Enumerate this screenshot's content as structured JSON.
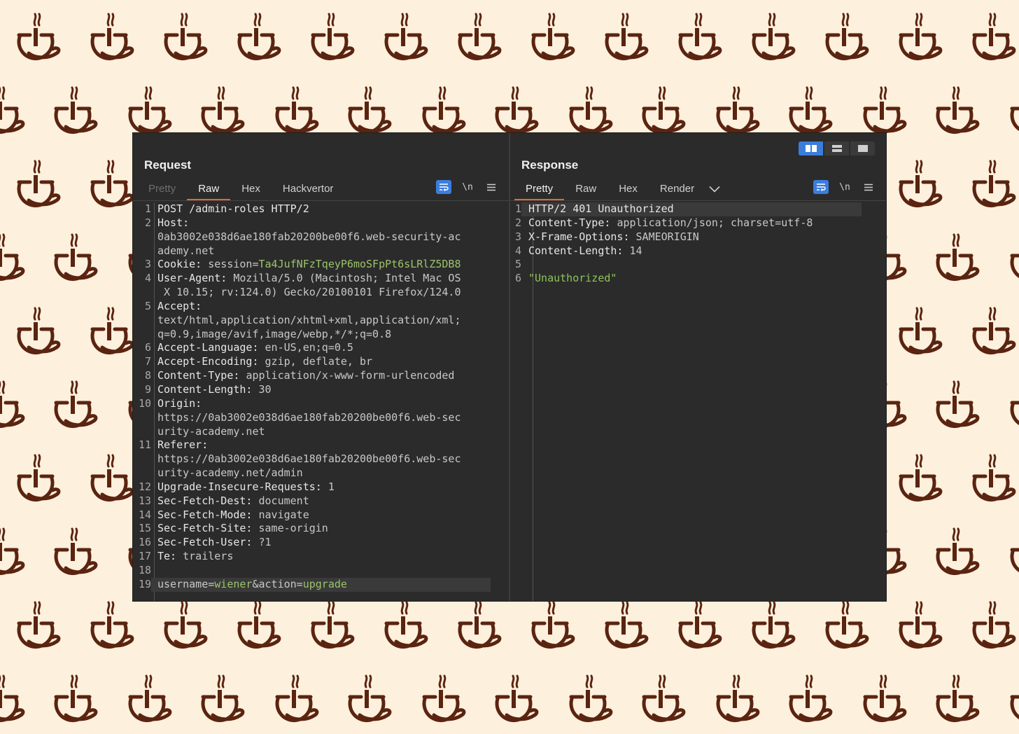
{
  "request": {
    "title": "Request",
    "tabs": [
      "Pretty",
      "Raw",
      "Hex",
      "Hackvertor"
    ],
    "newline_label": "\\n",
    "lines": {
      "l1": "POST /admin-roles HTTP/2",
      "l2": "Host:",
      "l2b": "0ab3002e038d6ae180fab20200be00f6.web-security-ac",
      "l2c": "ademy.net",
      "l3k": "Cookie:",
      "l3p": "session=",
      "l3v": "Ta4JufNFzTqeyP6moSFpPt6sLRlZ5DB8",
      "l4k": "User-Agent:",
      "l4v": "Mozilla/5.0 (Macintosh; Intel Mac OS",
      "l4b": " X 10.15; rv:124.0) Gecko/20100101 Firefox/124.0",
      "l5k": "Accept:",
      "l5b": "text/html,application/xhtml+xml,application/xml;",
      "l5c": "q=0.9,image/avif,image/webp,*/*;q=0.8",
      "l6k": "Accept-Language:",
      "l6v": "en-US,en;q=0.5",
      "l7k": "Accept-Encoding:",
      "l7v": "gzip, deflate, br",
      "l8k": "Content-Type:",
      "l8v": "application/x-www-form-urlencoded",
      "l9k": "Content-Length:",
      "l9v": "30",
      "l10k": "Origin:",
      "l10b": "https://0ab3002e038d6ae180fab20200be00f6.web-sec",
      "l10c": "urity-academy.net",
      "l11k": "Referer:",
      "l11b": "https://0ab3002e038d6ae180fab20200be00f6.web-sec",
      "l11c": "urity-academy.net/admin",
      "l12k": "Upgrade-Insecure-Requests:",
      "l12v": "1",
      "l13k": "Sec-Fetch-Dest:",
      "l13v": "document",
      "l14k": "Sec-Fetch-Mode:",
      "l14v": "navigate",
      "l15k": "Sec-Fetch-Site:",
      "l15v": "same-origin",
      "l16k": "Sec-Fetch-User:",
      "l16v": "?1",
      "l17k": "Te:",
      "l17v": "trailers",
      "l19a": "username=",
      "l19b": "wiener",
      "l19c": "&action=",
      "l19d": "upgrade"
    }
  },
  "response": {
    "title": "Response",
    "tabs": [
      "Pretty",
      "Raw",
      "Hex",
      "Render"
    ],
    "newline_label": "\\n",
    "lines": {
      "l1": "HTTP/2 401 Unauthorized",
      "l2k": "Content-Type:",
      "l2v": "application/json; charset=utf-8",
      "l3k": "X-Frame-Options:",
      "l3v": "SAMEORIGIN",
      "l4k": "Content-Length:",
      "l4v": "14",
      "l6": "\"Unauthorized\""
    }
  },
  "line_numbers": {
    "n1": "1",
    "n2": "2",
    "n3": "3",
    "n4": "4",
    "n5": "5",
    "n6": "6",
    "n7": "7",
    "n8": "8",
    "n9": "9",
    "n10": "10",
    "n11": "11",
    "n12": "12",
    "n13": "13",
    "n14": "14",
    "n15": "15",
    "n16": "16",
    "n17": "17",
    "n18": "18",
    "n19": "19"
  },
  "colors": {
    "background": "#fdf0dd",
    "pattern": "#5a2410",
    "panel": "#2b2b2b",
    "accent_tab": "#e8692a",
    "accent_button": "#3b7ddd",
    "syntax_green": "#9bc46b"
  },
  "icons": {
    "wallpaper": "coffee-cup-icon",
    "wrap": "word-wrap-icon",
    "menu": "hamburger-menu-icon",
    "chevron": "chevron-down-icon",
    "layout": [
      "side-by-side-layout-icon",
      "stacked-layout-icon",
      "single-pane-layout-icon"
    ]
  }
}
